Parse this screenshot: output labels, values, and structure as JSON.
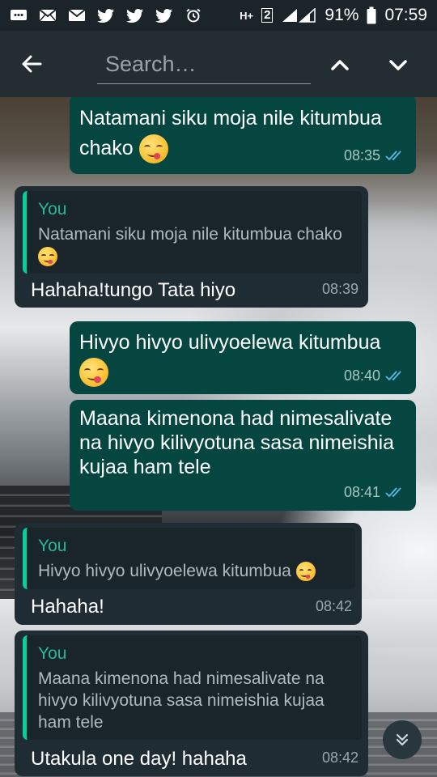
{
  "status_bar": {
    "battery": "91%",
    "time": "07:59",
    "network": "H+",
    "sim": "2"
  },
  "search": {
    "placeholder": "Search…",
    "value": ""
  },
  "messages": [
    {
      "type": "outgoing",
      "text": "Natamani siku moja nile kitumbua chako",
      "has_emoji": true,
      "time": "08:35",
      "status": "read"
    },
    {
      "type": "incoming_reply",
      "quote_author": "You",
      "quote_text": "Natamani siku moja nile kitumbua chako",
      "text": "Hahaha!tungo Tata hiyo",
      "time": "08:39"
    },
    {
      "type": "outgoing",
      "text": "Hivyo hivyo ulivyoelewa kitumbua",
      "has_emoji": true,
      "time": "08:40",
      "status": "read"
    },
    {
      "type": "outgoing",
      "text": "Maana kimenona had nimesalivate na hivyo kilivyotuna sasa nimeishia kujaa ham tele",
      "time": "08:41",
      "status": "read"
    },
    {
      "type": "incoming_reply",
      "quote_author": "You",
      "quote_text": "Hivyo hivyo ulivyoelewa kitumbua",
      "text": "Hahaha!",
      "time": "08:42"
    },
    {
      "type": "incoming_reply",
      "quote_author": "You",
      "quote_text": "Maana kimenona had nimesalivate na hivyo kilivyotuna sasa nimeishia kujaa ham tele",
      "text": "Utakula one day! hahaha",
      "time": "08:42"
    }
  ],
  "colors": {
    "outgoing_bubble": "#054740",
    "incoming_bubble": "#1f2c33",
    "quote_accent": "#06cf9c",
    "read_ticks": "#53bdeb"
  },
  "icons": {
    "back": "arrow-left-icon",
    "prev": "chevron-up-icon",
    "next": "chevron-down-icon",
    "scroll": "double-chevron-down-icon"
  }
}
